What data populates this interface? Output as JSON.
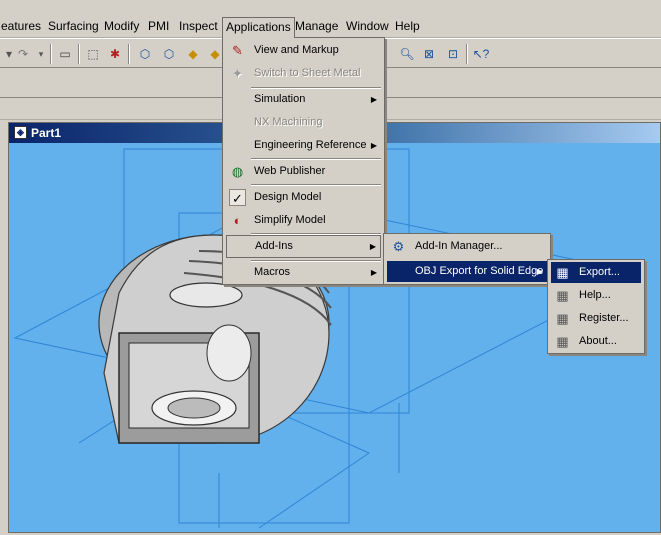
{
  "menubar": {
    "items": [
      "eatures",
      "Surfacing",
      "Modify",
      "PMI",
      "Inspect",
      "Applications",
      "Manage",
      "Window",
      "Help"
    ]
  },
  "document": {
    "title": "Part1"
  },
  "applications_menu": {
    "items": [
      {
        "label": "View and Markup",
        "icon": "view-markup-icon"
      },
      {
        "label": "Switch to Sheet Metal",
        "icon": "sheet-metal-icon",
        "disabled": true
      },
      {
        "label": "Simulation",
        "submenu": true
      },
      {
        "label": "NX Machining",
        "disabled": true
      },
      {
        "label": "Engineering Reference",
        "submenu": true
      },
      {
        "label": "Web Publisher",
        "icon": "globe-icon"
      },
      {
        "label": "Design Model",
        "icon": "checkmark-icon",
        "checked": true
      },
      {
        "label": "Simplify Model",
        "icon": "simplify-icon"
      },
      {
        "label": "Add-Ins",
        "submenu": true,
        "hover": true
      },
      {
        "label": "Macros",
        "submenu": true
      }
    ]
  },
  "addins_menu": {
    "items": [
      {
        "label": "Add-In Manager...",
        "icon": "addin-manager-icon"
      },
      {
        "label": "OBJ Export for Solid Edge",
        "submenu": true,
        "highlight": true
      }
    ]
  },
  "obj_menu": {
    "items": [
      {
        "label": "Export...",
        "icon": "calculator-icon",
        "highlight": true
      },
      {
        "label": "Help...",
        "icon": "calculator-icon"
      },
      {
        "label": "Register...",
        "icon": "calculator-icon"
      },
      {
        "label": "About...",
        "icon": "calculator-icon"
      }
    ]
  },
  "colors": {
    "viewport": "#62b0ec",
    "highlight": "#0a246a",
    "wire": "#3a8ad8"
  }
}
